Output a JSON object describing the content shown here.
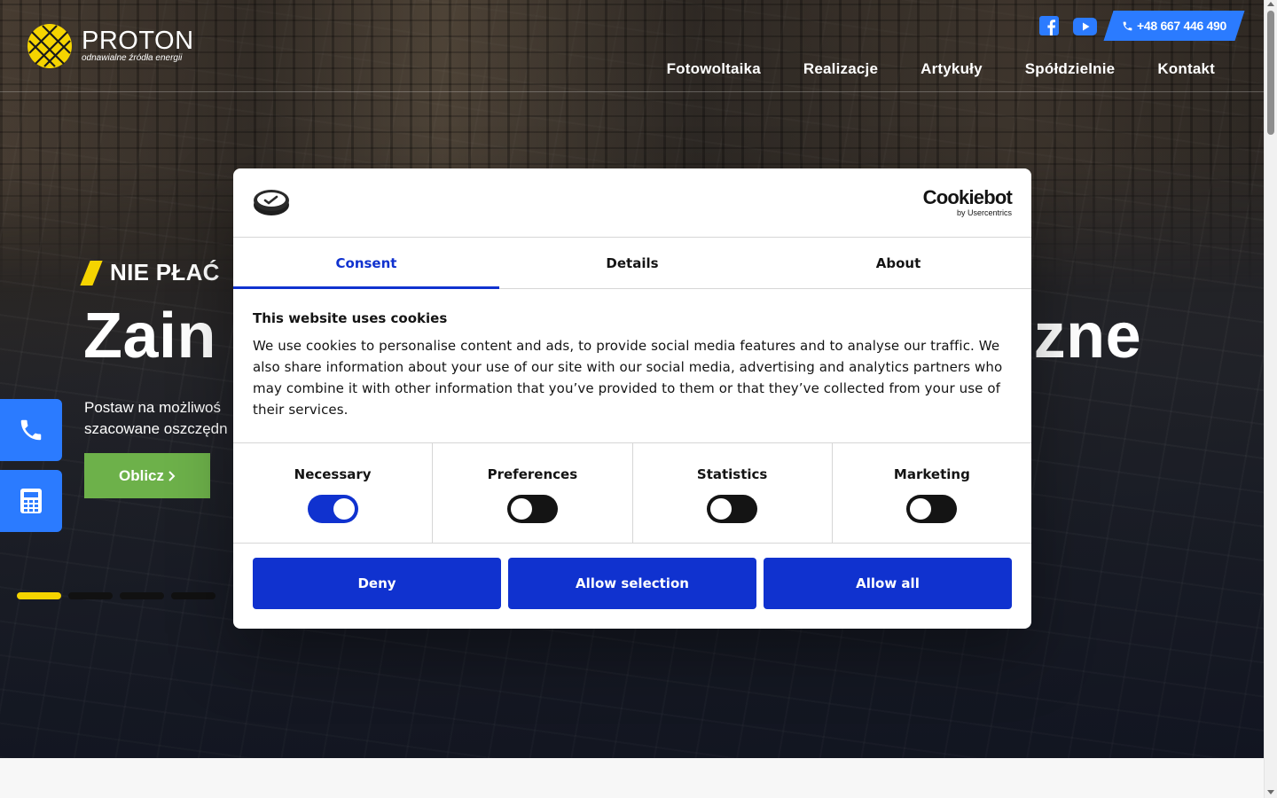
{
  "header": {
    "brand": "PROTON",
    "tagline": "odnawialne źródła energii",
    "phone": "+48 667 446 490",
    "nav": [
      "Fotowoltaika",
      "Realizacje",
      "Artykuły",
      "Spółdzielnie",
      "Kontakt"
    ]
  },
  "hero": {
    "eyebrow": "NIE PŁAĆ",
    "headline_left": "Zain",
    "headline_right": "ltaiczne",
    "lead_line1": "Postaw na możliwoś",
    "lead_line2": "szacowane oszczędn",
    "cta": "Oblicz",
    "slides_total": 4,
    "active_slide": 1
  },
  "cookie_dialog": {
    "brand_main": "Cookiebot",
    "brand_sub": "by Usercentrics",
    "tabs": [
      "Consent",
      "Details",
      "About"
    ],
    "active_tab": "Consent",
    "title": "This website uses cookies",
    "text": "We use cookies to personalise content and ads, to provide social media features and to analyse our traffic. We also share information about your use of our site with our social media, advertising and analytics partners who may combine it with other information that you’ve provided to them or that they’ve collected from your use of their services.",
    "categories": [
      {
        "label": "Necessary",
        "enabled": true
      },
      {
        "label": "Preferences",
        "enabled": false
      },
      {
        "label": "Statistics",
        "enabled": false
      },
      {
        "label": "Marketing",
        "enabled": false
      }
    ],
    "buttons": {
      "deny": "Deny",
      "allow_selection": "Allow selection",
      "allow_all": "Allow all"
    }
  },
  "colors": {
    "accent_blue": "#1032cf",
    "site_blue": "#2b7bff",
    "cta_green": "#6db14a",
    "brand_yellow": "#f5d400"
  },
  "icons": [
    "facebook-icon",
    "youtube-icon",
    "phone-icon",
    "calculator-icon",
    "chevron-right-icon"
  ]
}
